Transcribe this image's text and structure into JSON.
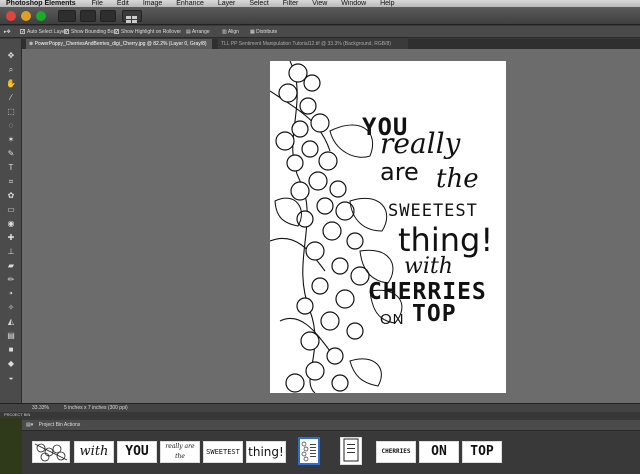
{
  "menubar": {
    "app_name": "Photoshop Elements",
    "items": [
      "File",
      "Edit",
      "Image",
      "Enhance",
      "Layer",
      "Select",
      "Filter",
      "View",
      "Window",
      "Help"
    ]
  },
  "options_bar": {
    "auto_select": "Auto Select Layer",
    "bounding_box": "Show Bounding Box",
    "highlight": "Show Highlight on Rollover",
    "arrange": "Arrange",
    "align": "Align",
    "distribute": "Distribute"
  },
  "tabs": [
    {
      "label": "PowerPoppy_CherriesAndBerries_digi_Cherry.jpg @ 82.2% (Layer 0, Gray/8)",
      "active": true
    },
    {
      "label": "TLL PP Sentiment Manipulation Tutorial12.tif @ 33.3% (Background, RGB/8)",
      "active": false
    }
  ],
  "document": {
    "lines": [
      "YOU",
      "really",
      "are",
      "the",
      "SWEETEST",
      "thing!",
      "with",
      "CHERRIES",
      "ON",
      "TOP"
    ]
  },
  "status": {
    "zoom": "33.33%",
    "doc_size": "5 inches x 7 inches (300 ppi)"
  },
  "project_bin": {
    "label": "PROJECT BIN",
    "actions": "Project Bin Actions",
    "thumbs": [
      "with",
      "YOU",
      "really are the",
      "SWEETEST",
      "thing!",
      "CHERRIES",
      "ON",
      "TOP"
    ]
  },
  "colors": {
    "foreground": "#19a6d8",
    "background": "#ffffff",
    "selection": "#2b6fd6"
  }
}
